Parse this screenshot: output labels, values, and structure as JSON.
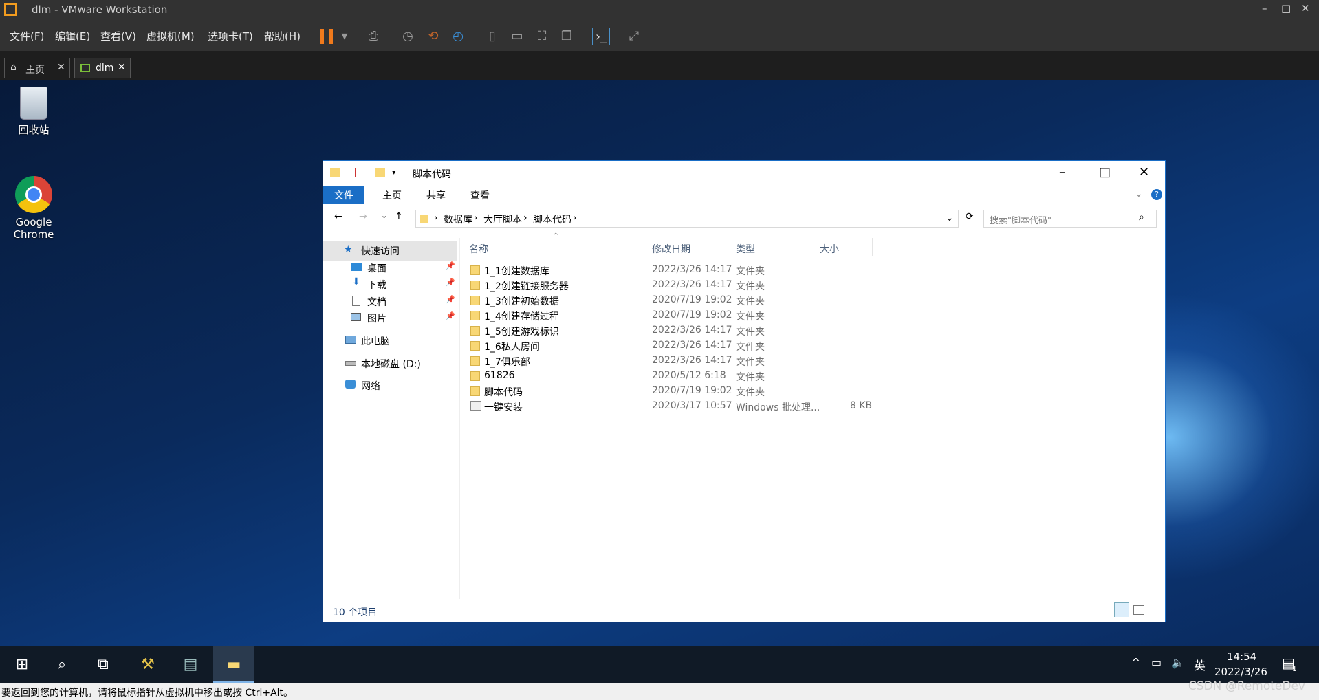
{
  "vm": {
    "title": "dlm - VMware Workstation",
    "menus": [
      "文件(F)",
      "编辑(E)",
      "查看(V)",
      "虚拟机(M)",
      "选项卡(T)",
      "帮助(H)"
    ],
    "tabs": [
      {
        "label": "主页"
      },
      {
        "label": "dlm"
      }
    ],
    "status": "要返回到您的计算机，请将鼠标指针从虚拟机中移出或按 Ctrl+Alt。",
    "watermark": "CSDN @RemoteDev"
  },
  "desktop": {
    "icons": [
      {
        "label": "回收站"
      },
      {
        "label": "Google Chrome"
      }
    ]
  },
  "explorer": {
    "title": "脚本代码",
    "ribbon_tabs": [
      "文件",
      "主页",
      "共享",
      "查看"
    ],
    "breadcrumb": [
      "数据库",
      "大厅脚本",
      "脚本代码"
    ],
    "search_placeholder": "搜索\"脚本代码\"",
    "sidebar": [
      {
        "label": "快速访问"
      },
      {
        "label": "桌面"
      },
      {
        "label": "下载"
      },
      {
        "label": "文档"
      },
      {
        "label": "图片"
      },
      {
        "label": "此电脑"
      },
      {
        "label": "本地磁盘 (D:)"
      },
      {
        "label": "网络"
      }
    ],
    "columns": {
      "name": "名称",
      "date": "修改日期",
      "type": "类型",
      "size": "大小"
    },
    "files": [
      {
        "name": "1_1创建数据库",
        "date": "2022/3/26 14:17",
        "type": "文件夹",
        "size": ""
      },
      {
        "name": "1_2创建链接服务器",
        "date": "2022/3/26 14:17",
        "type": "文件夹",
        "size": ""
      },
      {
        "name": "1_3创建初始数据",
        "date": "2020/7/19 19:02",
        "type": "文件夹",
        "size": ""
      },
      {
        "name": "1_4创建存储过程",
        "date": "2020/7/19 19:02",
        "type": "文件夹",
        "size": ""
      },
      {
        "name": "1_5创建游戏标识",
        "date": "2022/3/26 14:17",
        "type": "文件夹",
        "size": ""
      },
      {
        "name": "1_6私人房间",
        "date": "2022/3/26 14:17",
        "type": "文件夹",
        "size": ""
      },
      {
        "name": "1_7俱乐部",
        "date": "2022/3/26 14:17",
        "type": "文件夹",
        "size": ""
      },
      {
        "name": "61826",
        "date": "2020/5/12 6:18",
        "type": "文件夹",
        "size": ""
      },
      {
        "name": "脚本代码",
        "date": "2020/7/19 19:02",
        "type": "文件夹",
        "size": ""
      },
      {
        "name": "一键安装",
        "date": "2020/3/17 10:57",
        "type": "Windows 批处理...",
        "size": "8 KB"
      }
    ],
    "status": "10 个项目"
  },
  "taskbar": {
    "ime": "英",
    "time": "14:54",
    "date": "2022/3/26",
    "notification_count": "1"
  }
}
